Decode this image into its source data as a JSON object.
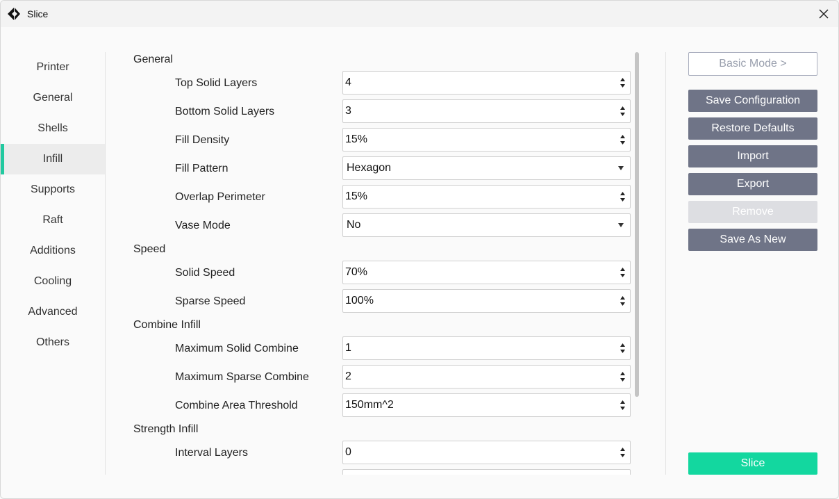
{
  "window": {
    "title": "Slice"
  },
  "sidebar": {
    "items": [
      {
        "label": "Printer",
        "active": false
      },
      {
        "label": "General",
        "active": false
      },
      {
        "label": "Shells",
        "active": false
      },
      {
        "label": "Infill",
        "active": true
      },
      {
        "label": "Supports",
        "active": false
      },
      {
        "label": "Raft",
        "active": false
      },
      {
        "label": "Additions",
        "active": false
      },
      {
        "label": "Cooling",
        "active": false
      },
      {
        "label": "Advanced",
        "active": false
      },
      {
        "label": "Others",
        "active": false
      }
    ]
  },
  "sections": {
    "general": {
      "title": "General",
      "top_solid_layers": {
        "label": "Top Solid Layers",
        "value": "4"
      },
      "bottom_solid_layers": {
        "label": "Bottom Solid Layers",
        "value": "3"
      },
      "fill_density": {
        "label": "Fill Density",
        "value": "15%"
      },
      "fill_pattern": {
        "label": "Fill Pattern",
        "value": "Hexagon"
      },
      "overlap_perimeter": {
        "label": "Overlap Perimeter",
        "value": "15%"
      },
      "vase_mode": {
        "label": "Vase Mode",
        "value": "No"
      }
    },
    "speed": {
      "title": "Speed",
      "solid_speed": {
        "label": "Solid Speed",
        "value": "70%"
      },
      "sparse_speed": {
        "label": "Sparse Speed",
        "value": "100%"
      }
    },
    "combine_infill": {
      "title": "Combine Infill",
      "max_solid_combine": {
        "label": "Maximum Solid Combine",
        "value": "1"
      },
      "max_sparse_combine": {
        "label": "Maximum Sparse Combine",
        "value": "2"
      },
      "combine_area_threshold": {
        "label": "Combine Area Threshold",
        "value": "150mm^2"
      }
    },
    "strength_infill": {
      "title": "Strength Infill",
      "interval_layers": {
        "label": "Interval Layers",
        "value": "0"
      }
    }
  },
  "actions": {
    "basic_mode": "Basic Mode >",
    "save_configuration": "Save Configuration",
    "restore_defaults": "Restore Defaults",
    "import": "Import",
    "export": "Export",
    "remove": "Remove",
    "save_as_new": "Save As New",
    "slice": "Slice"
  },
  "colors": {
    "accent": "#13d79f",
    "active_indicator": "#22c9a0",
    "button_dark": "#6f7487"
  }
}
